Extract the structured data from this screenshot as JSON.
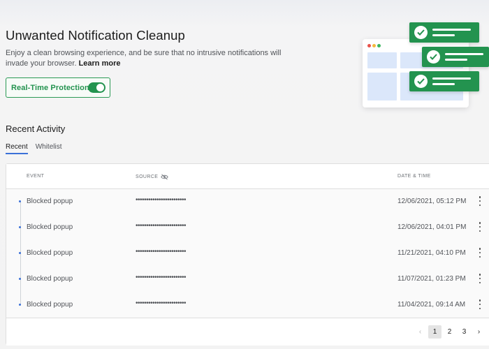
{
  "header": {
    "title": "Unwanted Notification Cleanup",
    "description": "Enjoy a clean browsing experience, and be sure that no intrusive notifications will invade your browser.",
    "learn_more": "Learn more"
  },
  "protection": {
    "label": "Real-Time Protection",
    "enabled": true
  },
  "recent_activity": {
    "title": "Recent Activity",
    "tabs": [
      {
        "label": "Recent",
        "active": true
      },
      {
        "label": "Whitelist",
        "active": false
      }
    ],
    "columns": {
      "event": "EVENT",
      "source": "SOURCE",
      "datetime": "DATE & TIME"
    },
    "rows": [
      {
        "event": "Blocked popup",
        "source": "••••••••••••••••••••••••",
        "datetime": "12/06/2021, 05:12 PM"
      },
      {
        "event": "Blocked popup",
        "source": "••••••••••••••••••••••••",
        "datetime": "12/06/2021, 04:01 PM"
      },
      {
        "event": "Blocked popup",
        "source": "••••••••••••••••••••••••",
        "datetime": "11/21/2021, 04:10 PM"
      },
      {
        "event": "Blocked popup",
        "source": "••••••••••••••••••••••••",
        "datetime": "11/07/2021, 01:23 PM"
      },
      {
        "event": "Blocked popup",
        "source": "••••••••••••••••••••••••",
        "datetime": "11/04/2021, 09:14 AM"
      }
    ]
  },
  "pagination": {
    "prev": "‹",
    "pages": [
      "1",
      "2",
      "3"
    ],
    "current": "1",
    "next": "›"
  },
  "icons": {
    "source_visibility": "eye-slash-icon",
    "row_menu": "kebab-menu-icon",
    "check": "check-icon"
  },
  "colors": {
    "accent_green": "#23934f",
    "accent_blue": "#3b71d8"
  }
}
